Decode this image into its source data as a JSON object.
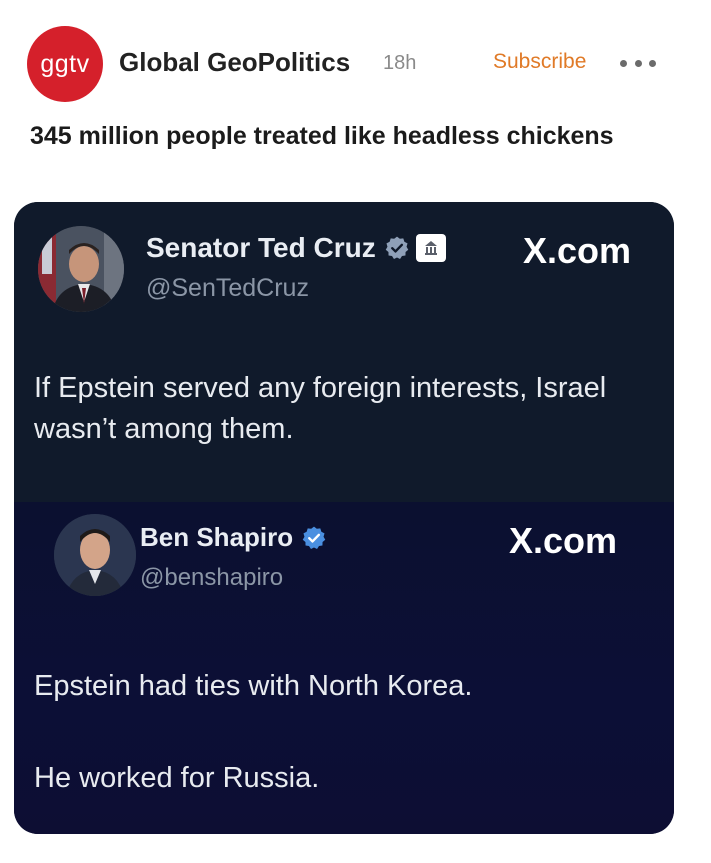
{
  "header": {
    "channel_logo_text": "ggtv",
    "channel_name": "Global GeoPolitics",
    "post_time": "18h",
    "subscribe_label": "Subscribe",
    "brand_color": "#d5202b",
    "subscribe_color": "#e07a27"
  },
  "post": {
    "title": "345 million people treated like headless chickens"
  },
  "image": {
    "tweets": [
      {
        "display_name": "Senator Ted Cruz",
        "handle": "@SenTedCruz",
        "badge_icons": [
          "verified-badge-icon",
          "government-building-icon"
        ],
        "source_label": "X.com",
        "text": "If Epstein served any foreign interests, Israel wasn’t among them."
      },
      {
        "display_name": "Ben Shapiro",
        "handle": "@benshapiro",
        "badge_icons": [
          "verified-badge-icon"
        ],
        "source_label": "X.com",
        "text_line_1": "Epstein had ties with North Korea.",
        "text_line_2": "He worked for Russia."
      }
    ]
  }
}
